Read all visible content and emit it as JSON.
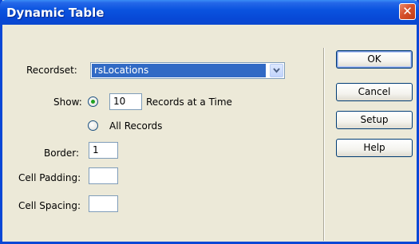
{
  "window": {
    "title": "Dynamic Table",
    "close_glyph": "✕"
  },
  "form": {
    "recordset_label": "Recordset:",
    "recordset_value": "rsLocations",
    "show_label": "Show:",
    "records_count": "10",
    "records_suffix": "Records at a Time",
    "all_records_label": "All Records",
    "border_label": "Border:",
    "border_value": "1",
    "cell_padding_label": "Cell Padding:",
    "cell_padding_value": "",
    "cell_spacing_label": "Cell Spacing:",
    "cell_spacing_value": ""
  },
  "buttons": {
    "ok": "OK",
    "cancel": "Cancel",
    "setup": "Setup",
    "help": "Help"
  },
  "colors": {
    "titlebar": "#0a53df",
    "selection": "#316ac5",
    "dialog_bg": "#ece9d8",
    "radio_dot": "#21a121"
  }
}
